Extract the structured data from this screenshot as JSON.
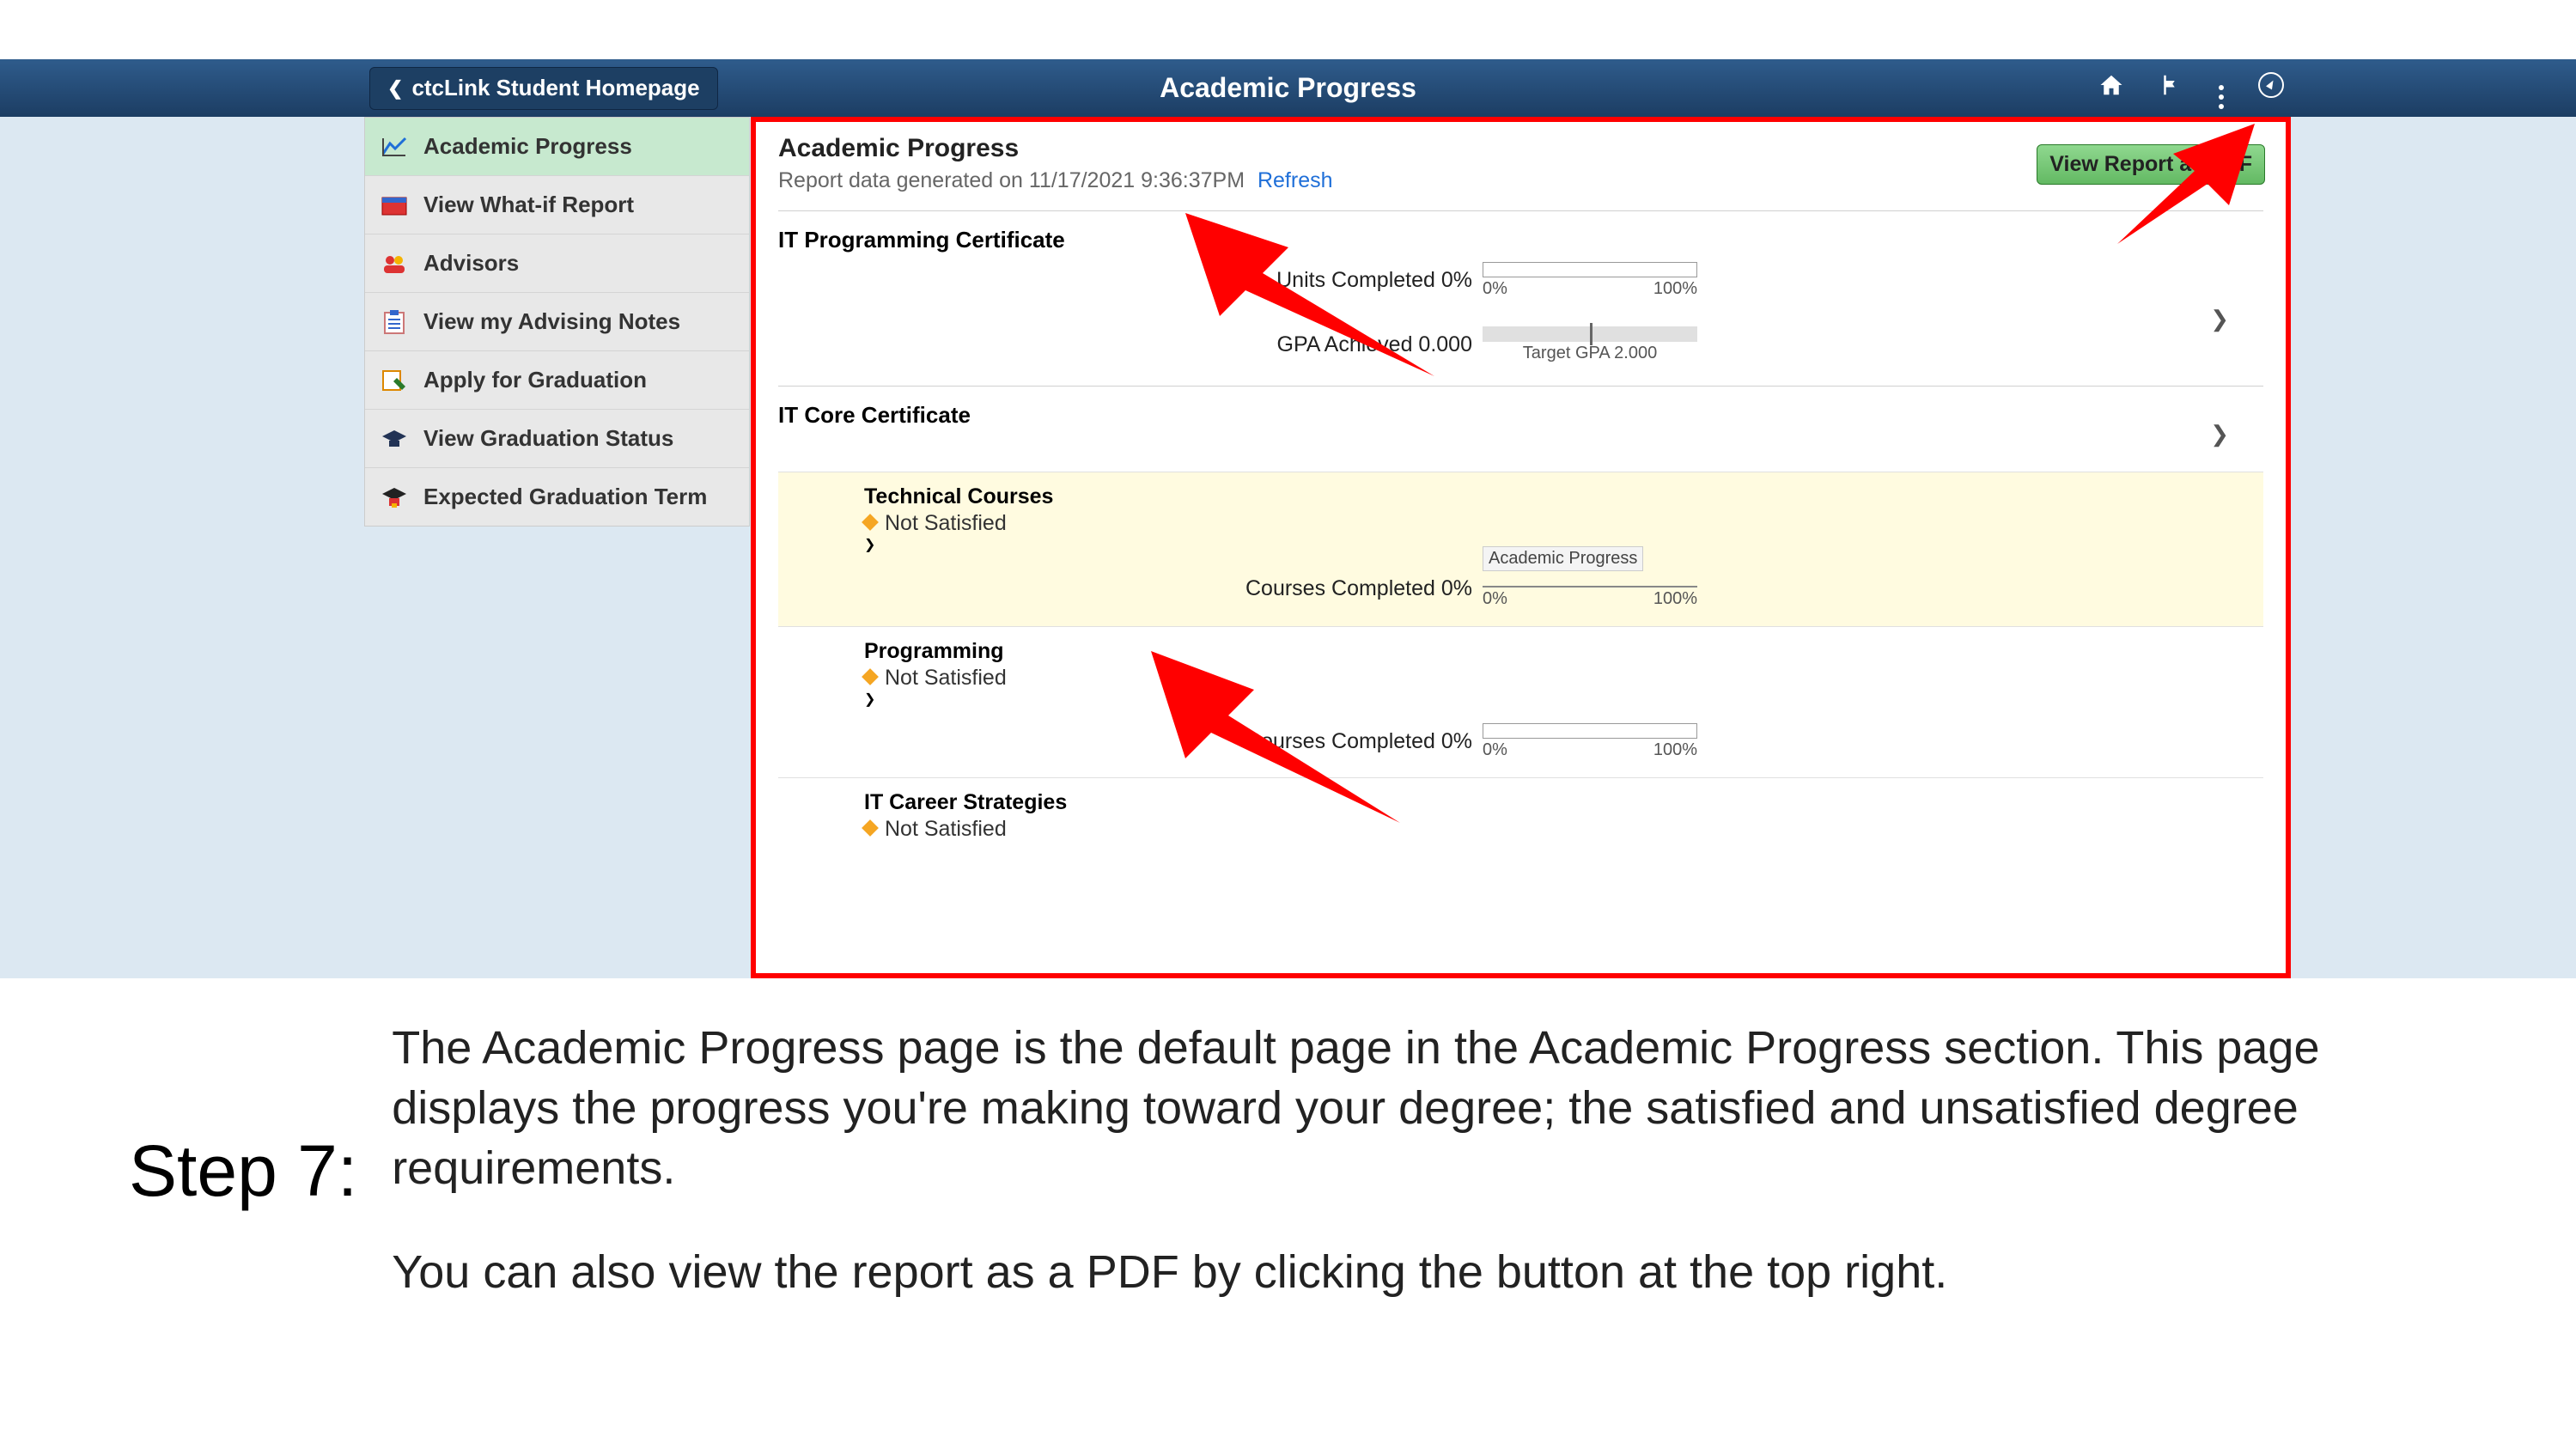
{
  "topbar": {
    "back_label": "ctcLink Student Homepage",
    "title": "Academic Progress"
  },
  "sidebar": {
    "items": [
      {
        "label": "Academic Progress",
        "icon": "chart"
      },
      {
        "label": "View What-if Report",
        "icon": "calendar"
      },
      {
        "label": "Advisors",
        "icon": "people"
      },
      {
        "label": "View my Advising Notes",
        "icon": "clipboard"
      },
      {
        "label": "Apply for Graduation",
        "icon": "apply"
      },
      {
        "label": "View Graduation Status",
        "icon": "gradcap-blue"
      },
      {
        "label": "Expected Graduation Term",
        "icon": "gradcap-gold"
      }
    ]
  },
  "content": {
    "heading": "Academic Progress",
    "generated_prefix": "Report data generated on ",
    "generated_ts": "11/17/2021 9:36:37PM",
    "refresh": "Refresh",
    "view_pdf": "View Report as PDF",
    "sec1": {
      "title": "IT Programming Certificate",
      "units_label": "Units Completed 0%",
      "gpa_label": "GPA Achieved  0.000",
      "gpa_caption": "Target GPA 2.000",
      "pct0": "0%",
      "pct100": "100%"
    },
    "sec2": {
      "title": "IT Core Certificate"
    },
    "sub1": {
      "title": "Technical Courses",
      "status": "Not Satisfied",
      "metric": "Courses Completed 0%",
      "tooltip": "Academic Progress",
      "pct0": "0%",
      "pct100": "100%"
    },
    "sub2": {
      "title": "Programming",
      "status": "Not Satisfied",
      "metric": "Courses Completed 0%",
      "pct0": "0%",
      "pct100": "100%"
    },
    "sub3": {
      "title": "IT Career Strategies",
      "status": "Not Satisfied"
    }
  },
  "step": {
    "label": "Step 7:",
    "p1": "The Academic Progress page is the default page in the Academic Progress section. This page displays the progress you're making toward your degree; the satisfied and unsatisfied degree requirements.",
    "p2": "You can also view the report as a PDF by clicking the button at the top right."
  },
  "chart_data": {
    "type": "bar",
    "series": [
      {
        "name": "Units Completed (%)",
        "values": [
          0
        ],
        "ylim": [
          0,
          100
        ]
      },
      {
        "name": "GPA Achieved",
        "values": [
          0.0
        ],
        "target": 2.0,
        "ylim": [
          0,
          4
        ]
      },
      {
        "name": "Technical Courses Completed (%)",
        "values": [
          0
        ],
        "ylim": [
          0,
          100
        ]
      },
      {
        "name": "Programming Courses Completed (%)",
        "values": [
          0
        ],
        "ylim": [
          0,
          100
        ]
      }
    ]
  }
}
